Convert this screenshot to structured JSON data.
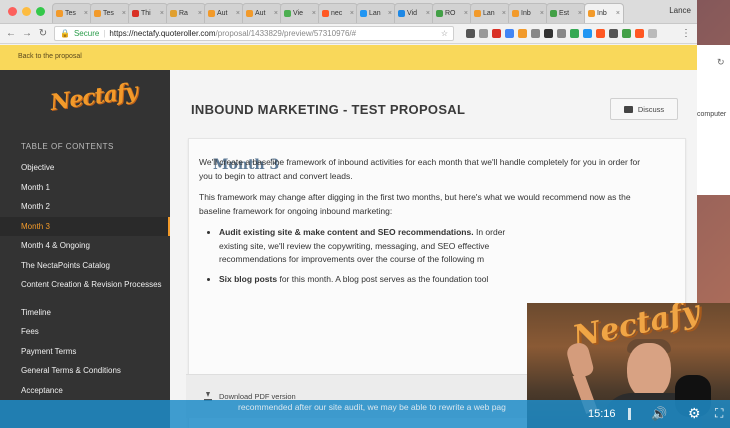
{
  "browser": {
    "profile": "Lance",
    "tabs": [
      {
        "label": "Tes",
        "color": "#f29a2a"
      },
      {
        "label": "Tes",
        "color": "#f29a2a"
      },
      {
        "label": "Thi",
        "color": "#d93025"
      },
      {
        "label": "Ra",
        "color": "#e0a030"
      },
      {
        "label": "Aut",
        "color": "#f29a2a"
      },
      {
        "label": "Aut",
        "color": "#f29a2a"
      },
      {
        "label": "Vie",
        "color": "#4caf50"
      },
      {
        "label": "nec",
        "color": "#ff5722"
      },
      {
        "label": "Lan",
        "color": "#2196f3"
      },
      {
        "label": "Vid",
        "color": "#1e88e5"
      },
      {
        "label": "RO",
        "color": "#43a047"
      },
      {
        "label": "Lan",
        "color": "#f29a2a"
      },
      {
        "label": "Inb",
        "color": "#f29a2a"
      },
      {
        "label": "Est",
        "color": "#43a047"
      },
      {
        "label": "Inb",
        "color": "#f29a2a",
        "active": true
      }
    ],
    "address": {
      "secure_label": "Secure",
      "host": "https://nectafy.quoteroller.com",
      "path": "/proposal/1433829/preview/57310976/#"
    }
  },
  "page": {
    "back_link": "Back to the proposal",
    "logo_text": "Nectafy",
    "toc_title": "TABLE OF CONTENTS",
    "toc_items": [
      {
        "label": "Objective"
      },
      {
        "label": "Month 1"
      },
      {
        "label": "Month 2"
      },
      {
        "label": "Month 3",
        "active": true
      },
      {
        "label": "Month 4 & Ongoing"
      },
      {
        "label": "The NectaPoints Catalog"
      },
      {
        "label": "Content Creation & Revision Processes",
        "two_line": true
      },
      {
        "label": "Timeline"
      },
      {
        "label": "Fees"
      },
      {
        "label": "Payment Terms"
      },
      {
        "label": "General Terms & Conditions"
      },
      {
        "label": "Acceptance"
      }
    ],
    "proposal_title": "INBOUND MARKETING - TEST PROPOSAL",
    "discuss_label": "Discuss",
    "section_title": "Month 3",
    "paragraph_1": "We'll create a baseline framework of inbound activities for each month that we'll handle completely for you in order for you to begin to attract and convert leads.",
    "paragraph_2": "This framework may change after digging in the first two months, but here's what we would recommend now as the baseline framework for ongoing inbound marketing:",
    "bullet_1_bold": "Audit existing site & make content and SEO recommendations.",
    "bullet_1_rest": " In order",
    "bullet_1_line2": "existing site, we'll review the copywriting, messaging, and SEO effective",
    "bullet_1_line3": "recommendations for improvements over the course of the following m",
    "bullet_2_bold": "Six blog posts",
    "bullet_2_rest": " for this month. A blog post serves as the foundation tool",
    "cut_off_text": "recommended after our site audit, we may be able to rewrite a web pag",
    "download_label": "Download PDF version"
  },
  "background_window": {
    "label": "computer"
  },
  "webcam": {
    "sign_text": "Nectafy"
  },
  "player": {
    "time": "15:16"
  }
}
